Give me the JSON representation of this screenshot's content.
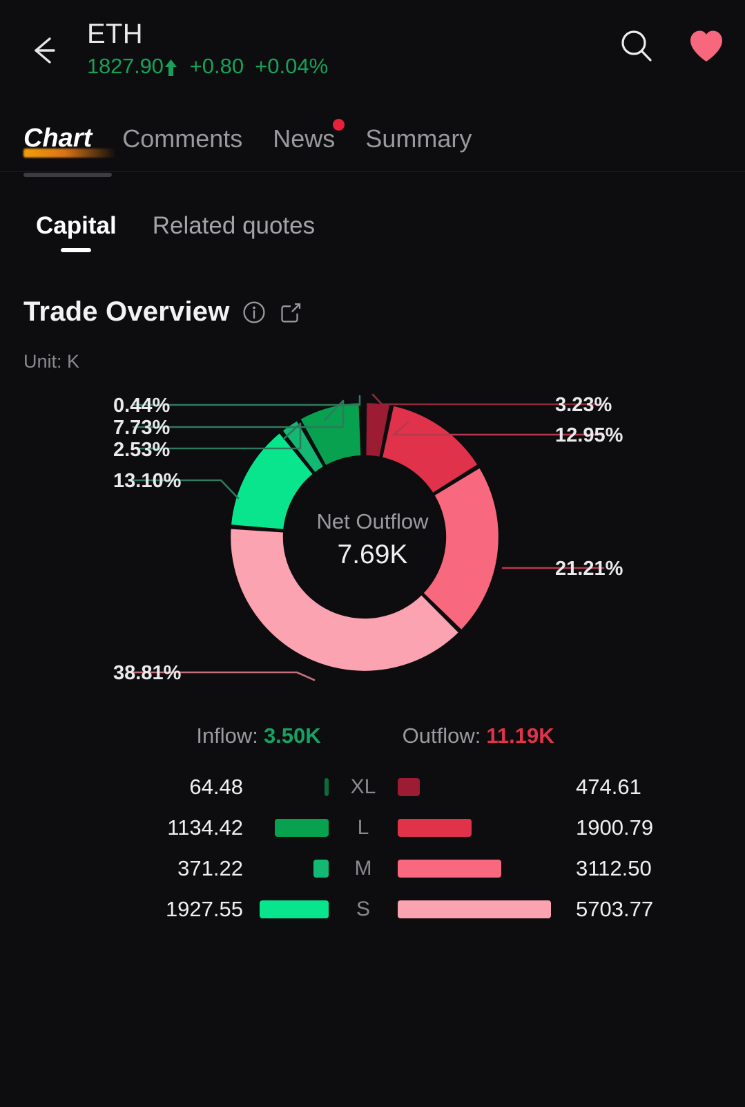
{
  "header": {
    "back_icon": "back-arrow-icon",
    "symbol": "ETH",
    "price": "1827.90",
    "trend_icon": "arrow-up-icon",
    "change": "+0.80",
    "change_pct": "+0.04%",
    "up_color": "#17a05a",
    "search_icon": "search-icon",
    "favorite_icon": "heart-icon",
    "favorite_color": "#f7687e"
  },
  "main_tabs": [
    {
      "label": "Chart",
      "active": true,
      "badge": false
    },
    {
      "label": "Comments",
      "active": false,
      "badge": false
    },
    {
      "label": "News",
      "active": false,
      "badge": true
    },
    {
      "label": "Summary",
      "active": false,
      "badge": false
    }
  ],
  "sub_tabs": [
    {
      "label": "Capital",
      "active": true
    },
    {
      "label": "Related quotes",
      "active": false
    }
  ],
  "section": {
    "title": "Trade Overview",
    "info_icon": "info-circle-icon",
    "share_icon": "share-export-icon",
    "unit": "Unit: K"
  },
  "chart_data": {
    "type": "pie",
    "title": "Trade Overview",
    "unit": "K",
    "center_caption": "Net Outflow",
    "center_value": "7.69K",
    "legend_position": "callout-labels",
    "categories": [
      "XL",
      "L",
      "M",
      "S"
    ],
    "series": [
      {
        "name": "Outflow",
        "values": [
          474.61,
          1900.79,
          3112.5,
          5703.77
        ],
        "total": "11.19K"
      },
      {
        "name": "Inflow",
        "values": [
          64.48,
          1134.42,
          371.22,
          1927.55
        ],
        "total": "3.50K"
      }
    ],
    "slices": [
      {
        "label": "3.23%",
        "pct": 3.23,
        "side": "right",
        "flow": "Outflow",
        "tier": "XL",
        "color": "#9b1c33"
      },
      {
        "label": "12.95%",
        "pct": 12.95,
        "side": "right",
        "flow": "Outflow",
        "tier": "L",
        "color": "#e0324a"
      },
      {
        "label": "21.21%",
        "pct": 21.21,
        "side": "right",
        "flow": "Outflow",
        "tier": "M",
        "color": "#f8697f"
      },
      {
        "label": "38.81%",
        "pct": 38.81,
        "side": "left",
        "flow": "Outflow",
        "tier": "S",
        "color": "#fba3b0"
      },
      {
        "label": "13.10%",
        "pct": 13.1,
        "side": "left",
        "flow": "Inflow",
        "tier": "S",
        "color": "#09e58d"
      },
      {
        "label": "2.53%",
        "pct": 2.53,
        "side": "left",
        "flow": "Inflow",
        "tier": "M",
        "color": "#13b873"
      },
      {
        "label": "7.73%",
        "pct": 7.73,
        "side": "left",
        "flow": "Inflow",
        "tier": "L",
        "color": "#08a14f"
      },
      {
        "label": "0.44%",
        "pct": 0.44,
        "side": "left",
        "flow": "Inflow",
        "tier": "XL",
        "color": "#0c6b3c"
      }
    ]
  },
  "flows": {
    "inflow_label": "Inflow:",
    "inflow_value": "3.50K",
    "outflow_label": "Outflow:",
    "outflow_value": "11.19K"
  },
  "rows": [
    {
      "tier": "XL",
      "in_value": "64.48",
      "out_value": "474.61",
      "in_bar_w": 6,
      "out_bar_w": 32,
      "in_color": "#0c6b3c",
      "out_color": "#9b1c33"
    },
    {
      "tier": "L",
      "in_value": "1134.42",
      "out_value": "1900.79",
      "in_bar_w": 78,
      "out_bar_w": 107,
      "in_color": "#08a14f",
      "out_color": "#e0324a"
    },
    {
      "tier": "M",
      "in_value": "371.22",
      "out_value": "3112.50",
      "in_bar_w": 22,
      "out_bar_w": 150,
      "in_color": "#13b873",
      "out_color": "#f8697f"
    },
    {
      "tier": "S",
      "in_value": "1927.55",
      "out_value": "5703.77",
      "in_bar_w": 100,
      "out_bar_w": 222,
      "in_color": "#09e58d",
      "out_color": "#fba3b0"
    }
  ]
}
